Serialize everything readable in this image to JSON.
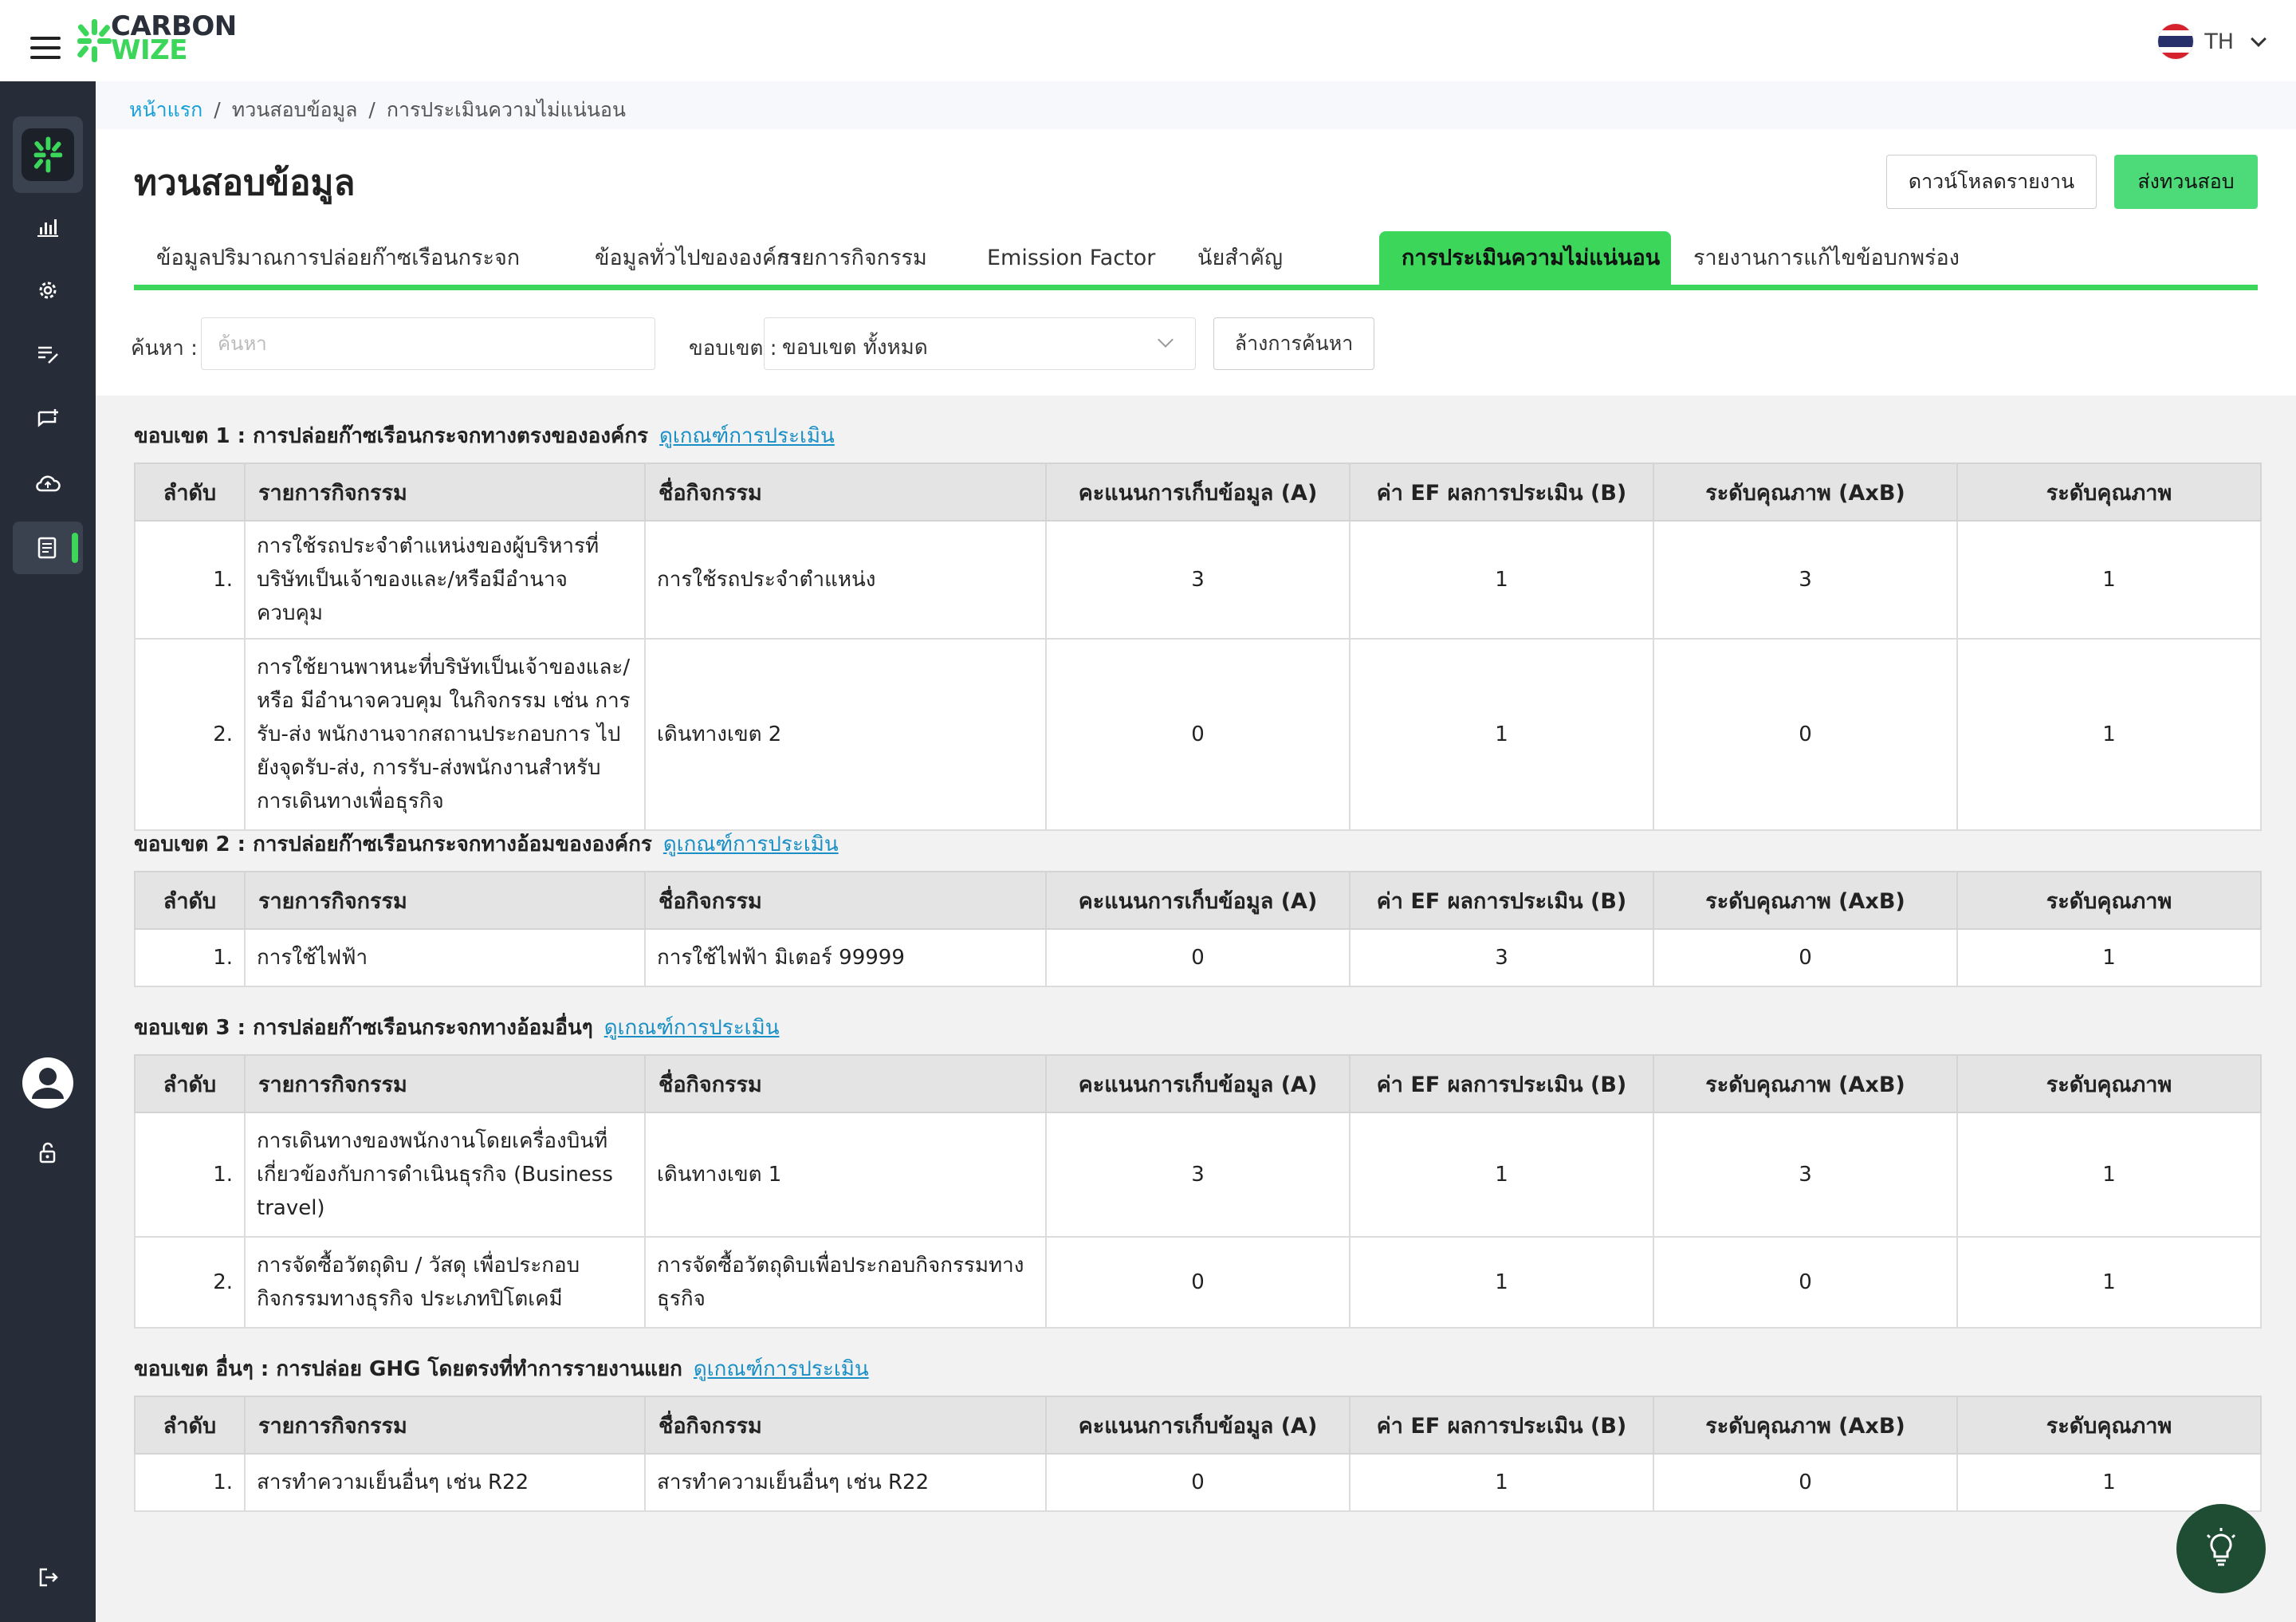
{
  "brand": {
    "line1": "CARBON",
    "line2": "WIZE"
  },
  "language": {
    "code": "TH"
  },
  "breadcrumb": {
    "home": "หน้าแรก",
    "section": "ทวนสอบข้อมูล",
    "current": "การประเมินความไม่แน่นอน"
  },
  "header": {
    "title": "ทวนสอบข้อมูล",
    "download_label": "ดาวน์โหลดรายงาน",
    "submit_label": "ส่งทวนสอบ"
  },
  "tabs": [
    {
      "label": "ข้อมูลปริมาณการปล่อยก๊าซเรือนกระจก"
    },
    {
      "label": "ข้อมูลทั่วไปขององค์กร"
    },
    {
      "label": "รายการกิจกรรม"
    },
    {
      "label": "Emission Factor"
    },
    {
      "label": "นัยสำคัญ"
    },
    {
      "label": "การประเมินความไม่แน่นอน",
      "active": true
    },
    {
      "label": "รายงานการแก้ไขข้อบกพร่อง"
    }
  ],
  "filters": {
    "search_label": "ค้นหา :",
    "search_placeholder": "ค้นหา",
    "search_value": "",
    "scope_label": "ขอบเขต :",
    "scope_value": "ขอบเขต ทั้งหมด",
    "clear_label": "ล้างการค้นหา"
  },
  "columns": {
    "idx": "ลำดับ",
    "activity": "รายการกิจกรรม",
    "name": "ชื่อกิจกรรม",
    "a": "คะแนนการเก็บข้อมูล (A)",
    "b": "ค่า EF ผลการประเมิน (B)",
    "axb": "ระดับคุณภาพ (AxB)",
    "quality": "ระดับคุณภาพ"
  },
  "criteria_link": "ดูเกณฑ์การประเมิน",
  "scopes": [
    {
      "title": "ขอบเขต 1 : การปล่อยก๊าซเรือนกระจกทางตรงขององค์กร",
      "rows": [
        {
          "idx": "1.",
          "activity": "การใช้รถประจำตำแหน่งของผู้บริหารที่บริษัทเป็นเจ้าของและ/หรือมีอำนาจควบคุม",
          "name": "การใช้รถประจำตำแหน่ง",
          "a": "3",
          "b": "1",
          "axb": "3",
          "quality": "1"
        },
        {
          "idx": "2.",
          "activity": "การใช้ยานพาหนะที่บริษัทเป็นเจ้าของและ/หรือ มีอำนาจควบคุม ในกิจกรรม เช่น การรับ-ส่ง พนักงานจากสถานประกอบการ ไปยังจุดรับ-ส่ง, การรับ-ส่งพนักงานสำหรับการเดินทางเพื่อธุรกิจ",
          "name": "เดินทางเขต 2",
          "a": "0",
          "b": "1",
          "axb": "0",
          "quality": "1"
        }
      ]
    },
    {
      "title": "ขอบเขต 2 : การปล่อยก๊าซเรือนกระจกทางอ้อมขององค์กร",
      "rows": [
        {
          "idx": "1.",
          "activity": "การใช้ไฟฟ้า",
          "name": "การใช้ไฟฟ้า มิเตอร์ 99999",
          "a": "0",
          "b": "3",
          "axb": "0",
          "quality": "1"
        }
      ]
    },
    {
      "title": "ขอบเขต 3 : การปล่อยก๊าซเรือนกระจกทางอ้อมอื่นๆ",
      "rows": [
        {
          "idx": "1.",
          "activity": "การเดินทางของพนักงานโดยเครื่องบินที่เกี่ยวข้องกับการดำเนินธุรกิจ (Business travel)",
          "name": "เดินทางเขต 1",
          "a": "3",
          "b": "1",
          "axb": "3",
          "quality": "1"
        },
        {
          "idx": "2.",
          "activity": "การจัดซื้อวัตถุดิบ / วัสดุ เพื่อประกอบกิจกรรมทางธุรกิจ ประเภทปิโตเคมี",
          "name": "การจัดซื้อวัตถุดิบเพื่อประกอบกิจกรรมทางธุรกิจ",
          "a": "0",
          "b": "1",
          "axb": "0",
          "quality": "1"
        }
      ]
    },
    {
      "title": "ขอบเขต อื่นๆ : การปล่อย GHG โดยตรงที่ทำการรายงานแยก",
      "rows": [
        {
          "idx": "1.",
          "activity": "สารทำความเย็นอื่นๆ เช่น R22",
          "name": "สารทำความเย็นอื่นๆ เช่น R22",
          "a": "0",
          "b": "1",
          "axb": "0",
          "quality": "1"
        }
      ]
    }
  ]
}
